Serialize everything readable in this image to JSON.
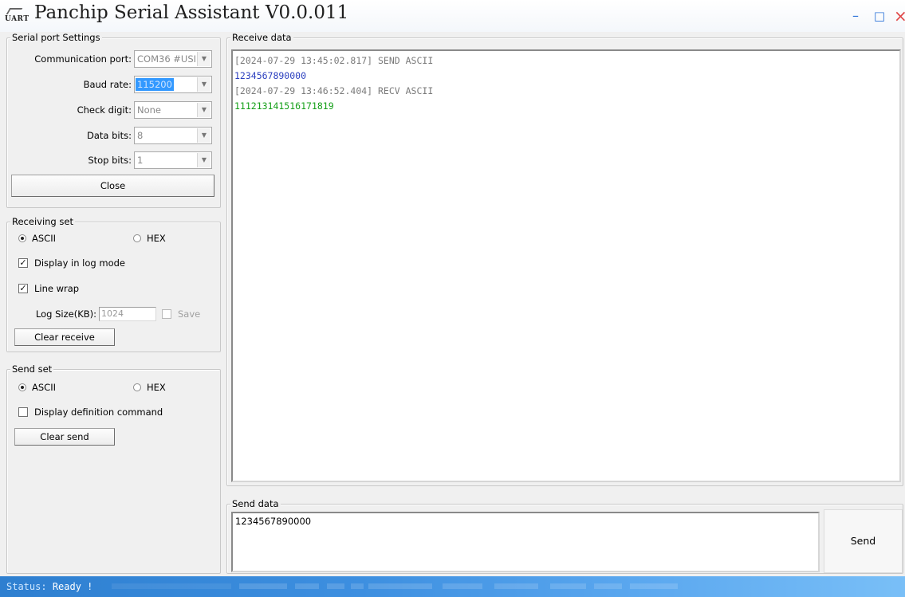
{
  "window": {
    "title": "Panchip Serial Assistant V0.0.011",
    "logo_text": "UART",
    "controls": {
      "minimize": "–",
      "maximize": "□",
      "close": "×"
    }
  },
  "serial_port": {
    "group_label": "Serial port Settings",
    "port": {
      "label": "Communication port:",
      "value": "COM36 #USI"
    },
    "baud": {
      "label": "Baud rate:",
      "value": "115200"
    },
    "check_digit": {
      "label": "Check digit:",
      "value": "None"
    },
    "data_bits": {
      "label": "Data bits:",
      "value": "8"
    },
    "stop_bits": {
      "label": "Stop bits:",
      "value": "1"
    },
    "close_button": "Close"
  },
  "receiving": {
    "group_label": "Receiving set",
    "ascii": "ASCII",
    "hex": "HEX",
    "mode_selected": "ASCII",
    "log_mode": {
      "label": "Display in log mode",
      "checked": true
    },
    "line_wrap": {
      "label": "Line wrap",
      "checked": true
    },
    "log_size": {
      "label": "Log Size(KB):",
      "value": "1024"
    },
    "save": {
      "label": "Save",
      "checked": false
    },
    "clear_button": "Clear receive"
  },
  "send_set": {
    "group_label": "Send set",
    "ascii": "ASCII",
    "hex": "HEX",
    "mode_selected": "ASCII",
    "display_cmd": {
      "label": "Display definition command",
      "checked": false
    },
    "clear_button": "Clear send"
  },
  "receive_data": {
    "group_label": "Receive data",
    "lines": [
      {
        "text": "[2024-07-29 13:45:02.817] SEND ASCII",
        "color": "#7a7a7a"
      },
      {
        "text": "1234567890000",
        "color": "#2b3fbf"
      },
      {
        "text": "[2024-07-29 13:46:52.404] RECV ASCII",
        "color": "#7a7a7a"
      },
      {
        "text": "111213141516171819",
        "color": "#16a01a"
      }
    ]
  },
  "send_data": {
    "group_label": "Send data",
    "value": "1234567890000",
    "send_button": "Send"
  },
  "status": {
    "label": "Status:",
    "value": "Ready !"
  }
}
